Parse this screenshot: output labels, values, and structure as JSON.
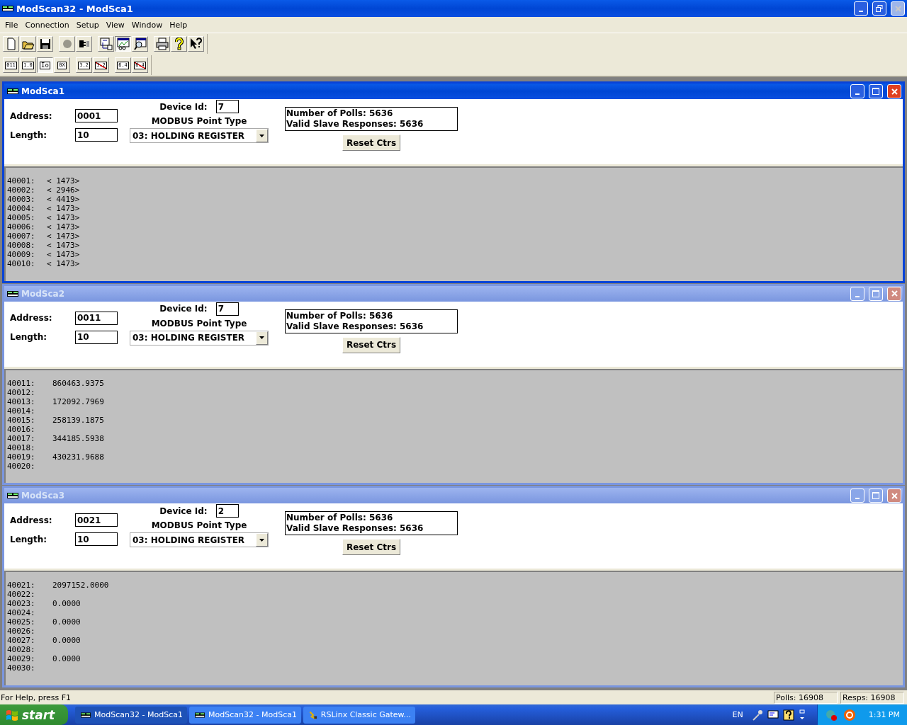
{
  "app": {
    "title": "ModScan32 - ModSca1"
  },
  "menu": [
    "File",
    "Connection",
    "Setup",
    "View",
    "Window",
    "Help"
  ],
  "toolbar_main": [
    [
      {
        "kind": "new",
        "pressed": false,
        "disabled": false
      },
      {
        "kind": "open",
        "pressed": false,
        "disabled": false
      },
      {
        "kind": "save",
        "pressed": false,
        "disabled": false
      }
    ],
    [
      {
        "kind": "connect",
        "pressed": false,
        "disabled": true
      },
      {
        "kind": "disconnect",
        "pressed": false,
        "disabled": false
      }
    ],
    [
      {
        "kind": "display",
        "pressed": false,
        "disabled": false
      },
      {
        "kind": "monitor",
        "pressed": true,
        "disabled": false
      },
      {
        "kind": "magnifier",
        "pressed": false,
        "disabled": false
      }
    ],
    [
      {
        "kind": "print",
        "pressed": false,
        "disabled": false
      },
      {
        "kind": "help",
        "pressed": false,
        "disabled": false
      },
      {
        "kind": "context-help",
        "pressed": false,
        "disabled": false
      }
    ]
  ],
  "toolbar_format": [
    [
      {
        "label": "011",
        "pressed": false,
        "crossed": false
      },
      {
        "label": "1.0",
        "pressed": false,
        "crossed": false
      },
      {
        "label": "Io",
        "pressed": true,
        "crossed": false
      },
      {
        "label": "0X",
        "pressed": false,
        "crossed": false
      }
    ],
    [
      {
        "label": "3.2",
        "pressed": false,
        "crossed": false
      },
      {
        "label": "3.2",
        "pressed": false,
        "crossed": true
      }
    ],
    [
      {
        "label": "6.4",
        "pressed": false,
        "crossed": false
      },
      {
        "label": "6.4",
        "pressed": false,
        "crossed": true
      }
    ]
  ],
  "windows": [
    {
      "title": "ModSca1",
      "active": true,
      "kind": "integer",
      "address_label": "Address:",
      "address": "0001",
      "length_label": "Length:",
      "length": "10",
      "device_label": "Device Id:",
      "device_id": "7",
      "point_type_label": "MODBUS Point Type",
      "point_type": "03: HOLDING REGISTER",
      "polls": "Number of Polls: 5636",
      "responses": "Valid Slave Responses: 5636",
      "reset": "Reset Ctrs",
      "rows": [
        {
          "address": "40001:",
          "value": "< 1473>"
        },
        {
          "address": "40002:",
          "value": "< 2946>"
        },
        {
          "address": "40003:",
          "value": "< 4419>"
        },
        {
          "address": "40004:",
          "value": "< 1473>"
        },
        {
          "address": "40005:",
          "value": "< 1473>"
        },
        {
          "address": "40006:",
          "value": "< 1473>"
        },
        {
          "address": "40007:",
          "value": "< 1473>"
        },
        {
          "address": "40008:",
          "value": "< 1473>"
        },
        {
          "address": "40009:",
          "value": "< 1473>"
        },
        {
          "address": "40010:",
          "value": "< 1473>"
        }
      ]
    },
    {
      "title": "ModSca2",
      "active": false,
      "kind": "float",
      "address_label": "Address:",
      "address": "0011",
      "length_label": "Length:",
      "length": "10",
      "device_label": "Device Id:",
      "device_id": "7",
      "point_type_label": "MODBUS Point Type",
      "point_type": "03: HOLDING REGISTER",
      "polls": "Number of Polls: 5636",
      "responses": "Valid Slave Responses: 5636",
      "reset": "Reset Ctrs",
      "rows": [
        {
          "address": "40011:",
          "value": "860463.9375"
        },
        {
          "address": "40012:"
        },
        {
          "address": "40013:",
          "value": "172092.7969"
        },
        {
          "address": "40014:"
        },
        {
          "address": "40015:",
          "value": "258139.1875"
        },
        {
          "address": "40016:"
        },
        {
          "address": "40017:",
          "value": "344185.5938"
        },
        {
          "address": "40018:"
        },
        {
          "address": "40019:",
          "value": "430231.9688"
        },
        {
          "address": "40020:"
        }
      ]
    },
    {
      "title": "ModSca3",
      "active": false,
      "kind": "float",
      "address_label": "Address:",
      "address": "0021",
      "length_label": "Length:",
      "length": "10",
      "device_label": "Device Id:",
      "device_id": "2",
      "point_type_label": "MODBUS Point Type",
      "point_type": "03: HOLDING REGISTER",
      "polls": "Number of Polls: 5636",
      "responses": "Valid Slave Responses: 5636",
      "reset": "Reset Ctrs",
      "rows": [
        {
          "address": "40021:",
          "value": "2097152.0000"
        },
        {
          "address": "40022:"
        },
        {
          "address": "40023:",
          "value": "0.0000"
        },
        {
          "address": "40024:"
        },
        {
          "address": "40025:",
          "value": "0.0000"
        },
        {
          "address": "40026:"
        },
        {
          "address": "40027:",
          "value": "0.0000"
        },
        {
          "address": "40028:"
        },
        {
          "address": "40029:",
          "value": "0.0000"
        },
        {
          "address": "40030:"
        }
      ]
    }
  ],
  "status_bar": {
    "help": "For Help, press F1",
    "polls": "Polls: 16908",
    "responses": "Resps: 16908"
  },
  "taskbar": {
    "start": "start",
    "tasks": [
      {
        "label": "ModScan32 - ModSca1",
        "kind": "modscan",
        "selected": true
      },
      {
        "label": "ModScan32 - ModSca1",
        "kind": "modscan",
        "selected": false
      },
      {
        "label": "RSLinx Classic Gatew...",
        "kind": "rslinx",
        "selected": false
      }
    ],
    "language": "EN",
    "clock": "1:31 PM"
  }
}
